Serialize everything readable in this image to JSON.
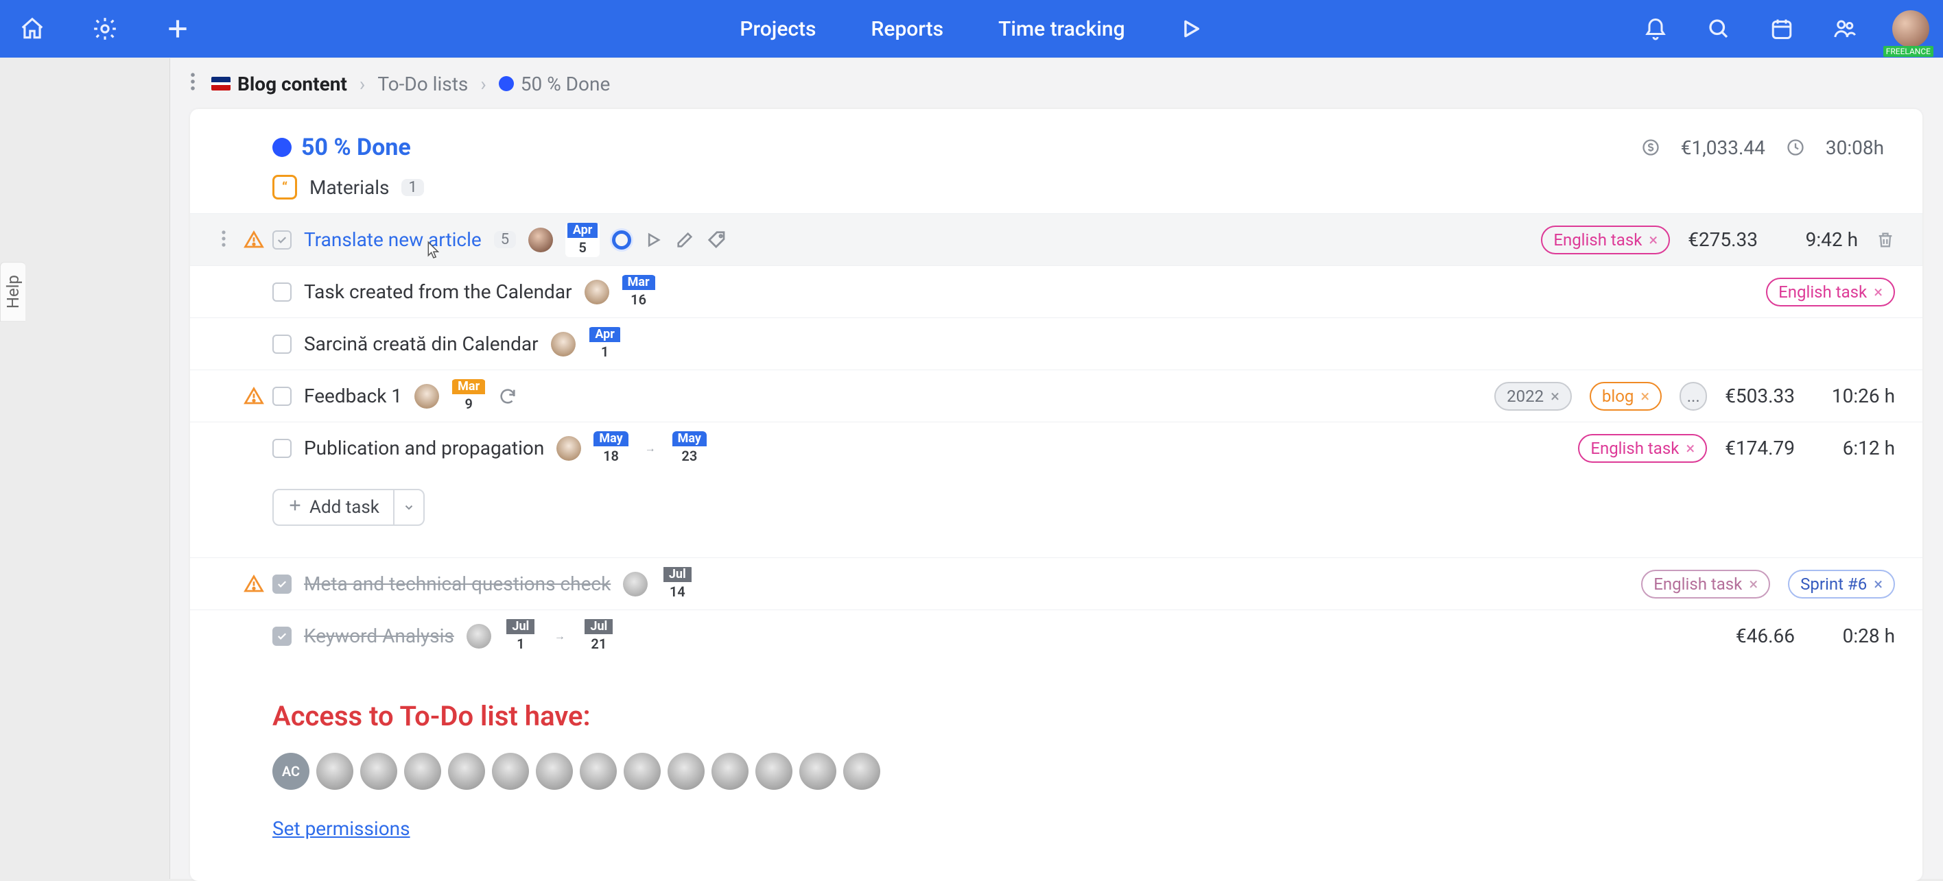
{
  "nav": {
    "projects": "Projects",
    "reports": "Reports",
    "tracking": "Time tracking"
  },
  "topbar": {
    "freelance_badge": "FREELANCE"
  },
  "help_tab": "Help",
  "breadcrumbs": {
    "project": "Blog content",
    "group": "To-Do lists",
    "list": "50 % Done"
  },
  "list": {
    "title": "50 % Done",
    "budget_label": "€1,033.44",
    "time_label": "30:08h",
    "materials_label": "Materials",
    "materials_count": "1"
  },
  "tags": {
    "english": "English task",
    "year2022": "2022",
    "blog": "blog",
    "more": "...",
    "sprint6": "Sprint #6"
  },
  "tasks": [
    {
      "title": "Translate new article",
      "subtask_count": "5",
      "date": {
        "month": "Apr",
        "day": "5"
      },
      "budget": "€275.33",
      "hours": "9:42 h"
    },
    {
      "title": "Task created from the Calendar",
      "date": {
        "month": "Mar",
        "day": "16"
      }
    },
    {
      "title": "Sarcină creată din Calendar",
      "date": {
        "month": "Apr",
        "day": "1"
      }
    },
    {
      "title": "Feedback 1",
      "date": {
        "month": "Mar",
        "day": "9"
      },
      "budget": "€503.33",
      "hours": "10:26 h"
    },
    {
      "title": "Publication and propagation",
      "date_start": {
        "month": "May",
        "day": "18"
      },
      "date_end": {
        "month": "May",
        "day": "23"
      },
      "budget": "€174.79",
      "hours": "6:12 h"
    },
    {
      "title": "Meta and technical questions check",
      "date": {
        "month": "Jul",
        "day": "14"
      }
    },
    {
      "title": "Keyword Analysis",
      "date_start": {
        "month": "Jul",
        "day": "1"
      },
      "date_end": {
        "month": "Jul",
        "day": "21"
      },
      "budget": "€46.66",
      "hours": "0:28 h"
    }
  ],
  "add_task_label": "Add task",
  "access": {
    "title": "Access to To-Do list have:",
    "permissions_link": "Set permissions",
    "avatar_initials": "AC"
  }
}
